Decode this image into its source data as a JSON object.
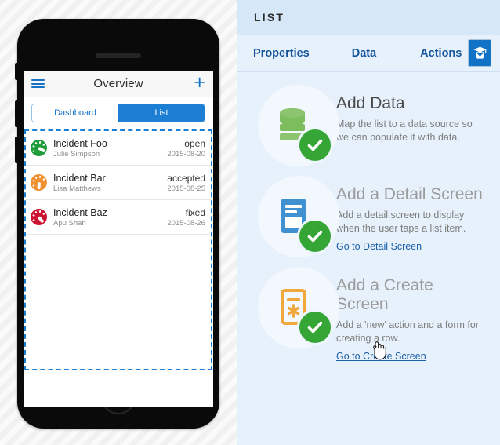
{
  "phone": {
    "navbar": {
      "menu_icon": "hamburger-icon",
      "title": "Overview",
      "add_icon": "plus-icon",
      "add_label": "+"
    },
    "segmented": {
      "options": [
        {
          "label": "Dashboard",
          "active": false
        },
        {
          "label": "List",
          "active": true
        }
      ]
    },
    "list_rows": [
      {
        "icon": "gauge-icon",
        "icon_color": "#1f9d3a",
        "needle_angle": -62,
        "title": "Incident Foo",
        "status": "open",
        "subtitle": "Julie Simpson",
        "date": "2015-08-20"
      },
      {
        "icon": "gauge-icon",
        "icon_color": "#f0912f",
        "needle_angle": 4,
        "title": "Incident Bar",
        "status": "accepted",
        "subtitle": "Lisa Matthews",
        "date": "2015-08-25"
      },
      {
        "icon": "gauge-icon",
        "icon_color": "#cc1431",
        "needle_angle": -38,
        "title": "Incident Baz",
        "status": "fixed",
        "subtitle": "Apu Shah",
        "date": "2015-08-26"
      }
    ]
  },
  "panel": {
    "header_title": "LIST",
    "tabs": [
      {
        "label": "Properties"
      },
      {
        "label": "Data"
      },
      {
        "label": "Actions"
      }
    ],
    "wizard_button_icon": "wizard-hat-icon",
    "steps": [
      {
        "icon": "database-icon",
        "icon_color": "#7dbd5e",
        "badge": "check-icon",
        "badge_color": "#35a635",
        "heading": "Add Data",
        "description": "Map the list to a data source so we can populate it with data.",
        "link": null,
        "completed": true
      },
      {
        "icon": "detail-screen-icon",
        "icon_color": "#3f91d2",
        "badge": "check-icon",
        "badge_color": "#35a635",
        "heading": "Add a Detail Screen",
        "description": "Add a detail screen to display when the user taps a list item.",
        "link": "Go to Detail Screen",
        "completed": true
      },
      {
        "icon": "create-screen-icon",
        "icon_color": "#f0a73c",
        "badge": "check-icon",
        "badge_color": "#35a635",
        "heading": "Add a Create Screen",
        "description": "Add a 'new' action and a form for creating a row.",
        "link": "Go to Create Screen",
        "completed": true
      }
    ]
  },
  "colors": {
    "panel_background": "#e6f1fb",
    "panel_header": "#d6e8f7",
    "tab_text": "#14549c",
    "accent_blue": "#1273c6",
    "selection_outline": "#1b7fd6",
    "success_green": "#35a635"
  },
  "cursor": {
    "type": "pointing-hand-cursor"
  }
}
